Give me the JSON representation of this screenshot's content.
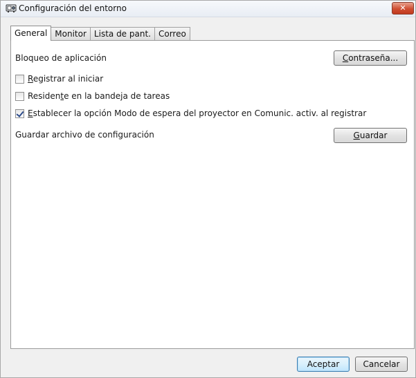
{
  "window": {
    "title": "Configuración del entorno",
    "close_label": "✕"
  },
  "tabs": [
    {
      "label": "General",
      "active": true
    },
    {
      "label": "Monitor",
      "active": false
    },
    {
      "label": "Lista de pant.",
      "active": false
    },
    {
      "label": "Correo",
      "active": false
    }
  ],
  "general": {
    "app_lock_label": "Bloqueo de aplicación",
    "password_button": {
      "u": "C",
      "rest": "ontraseña..."
    },
    "register_on_start": {
      "u": "R",
      "rest": "egistrar al iniciar",
      "checked": false
    },
    "resident_tray": {
      "pre": "Residen",
      "u": "t",
      "rest": "e en la bandeja de tareas",
      "checked": false
    },
    "standby_option": {
      "u": "E",
      "rest": "stablecer la opción Modo de espera del proyector en Comunic. activ. al registrar",
      "checked": true
    },
    "save_config_label": "Guardar archivo de configuración",
    "save_button": {
      "u": "G",
      "rest": "uardar"
    }
  },
  "footer": {
    "ok_label": "Aceptar",
    "cancel_label": "Cancelar"
  }
}
